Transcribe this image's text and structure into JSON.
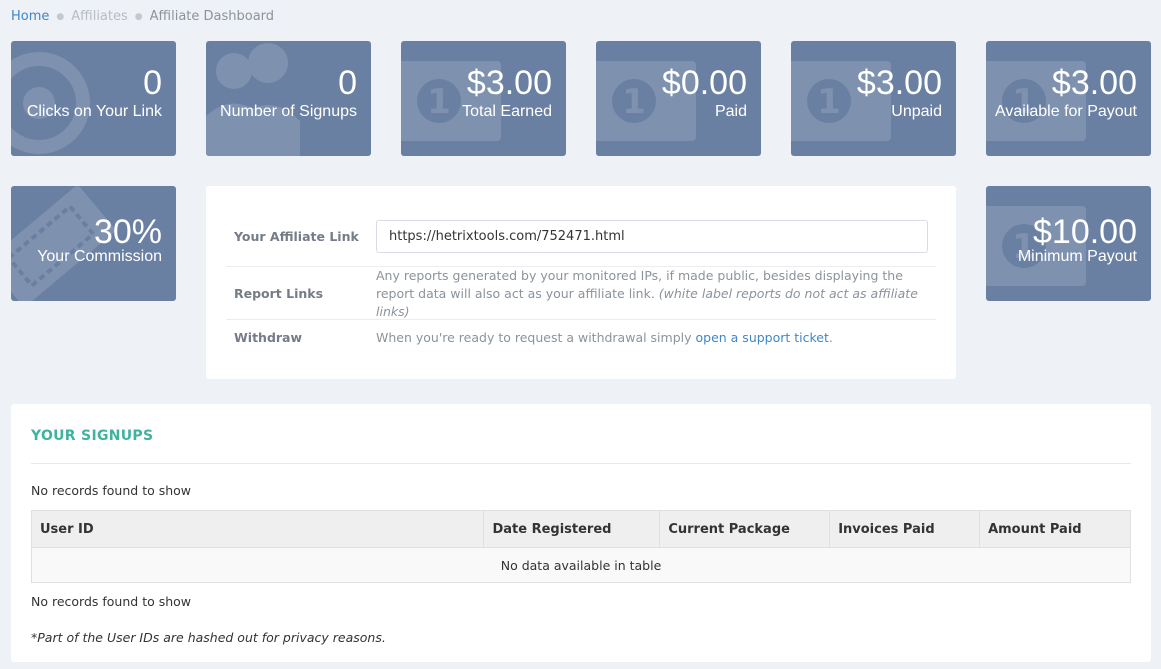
{
  "breadcrumb": {
    "home": "Home",
    "affiliates": "Affiliates",
    "current": "Affiliate Dashboard"
  },
  "stats": [
    {
      "value": "0",
      "label": "Clicks on Your Link",
      "icon": "target-icon"
    },
    {
      "value": "0",
      "label": "Number of Signups",
      "icon": "users-icon"
    },
    {
      "value": "$3.00",
      "label": "Total Earned",
      "icon": "money-icon"
    },
    {
      "value": "$0.00",
      "label": "Paid",
      "icon": "money-icon"
    },
    {
      "value": "$3.00",
      "label": "Unpaid",
      "icon": "money-icon"
    },
    {
      "value": "$3.00",
      "label": "Available for Payout",
      "icon": "money-icon"
    },
    {
      "value": "30%",
      "label": "Your Commission",
      "icon": "ticket-icon"
    },
    {
      "value": "$10.00",
      "label": "Minimum Payout",
      "icon": "money-icon"
    }
  ],
  "info": {
    "link_label": "Your Affiliate Link",
    "link_value": "https://hetrixtools.com/752471.html",
    "reports_label": "Report Links",
    "reports_text": "Any reports generated by your monitored IPs, if made public, besides displaying the report data will also act as your affiliate link.",
    "reports_note": "(white label reports do not act as affiliate links)",
    "withdraw_label": "Withdraw",
    "withdraw_text": "When you're ready to request a withdrawal simply",
    "withdraw_link": "open a support ticket",
    "withdraw_end": "."
  },
  "signups": {
    "title": "YOUR SIGNUPS",
    "no_records_top": "No records found to show",
    "columns": [
      "User ID",
      "Date Registered",
      "Current Package",
      "Invoices Paid",
      "Amount Paid"
    ],
    "empty": "No data available in table",
    "no_records_bottom": "No records found to show",
    "footnote": "*Part of the User IDs are hashed out for privacy reasons."
  },
  "colors": {
    "stat_bg": "#6a80a2",
    "accent_link": "#3f87c6",
    "title_teal": "#3fb2a0"
  }
}
